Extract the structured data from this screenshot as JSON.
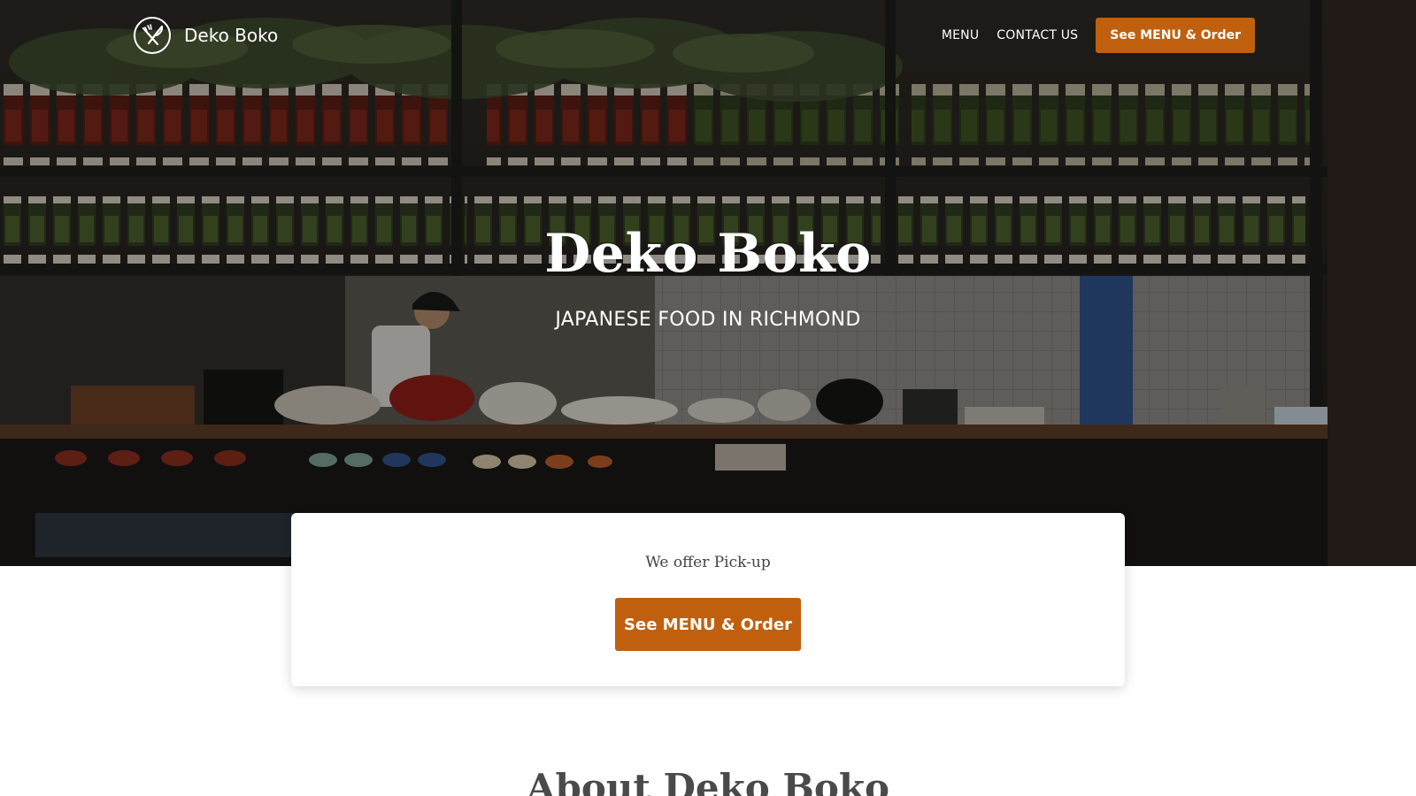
{
  "header": {
    "brand_name": "Deko Boko",
    "logo_icon": "knife-fork-icon",
    "nav": [
      {
        "label": "MENU"
      },
      {
        "label": "CONTACT US"
      }
    ],
    "cta_label": "See MENU & Order"
  },
  "hero": {
    "title": "Deko Boko",
    "subtitle": "JAPANESE FOOD IN RICHMOND",
    "background_image": "restaurant-kitchen-shelves-photo"
  },
  "pickup": {
    "text": "We offer Pick-up",
    "cta_label": "See MENU & Order"
  },
  "about": {
    "heading": "About Deko Boko"
  },
  "colors": {
    "accent": "#c0600e",
    "text_dark": "#444444",
    "white": "#ffffff"
  }
}
